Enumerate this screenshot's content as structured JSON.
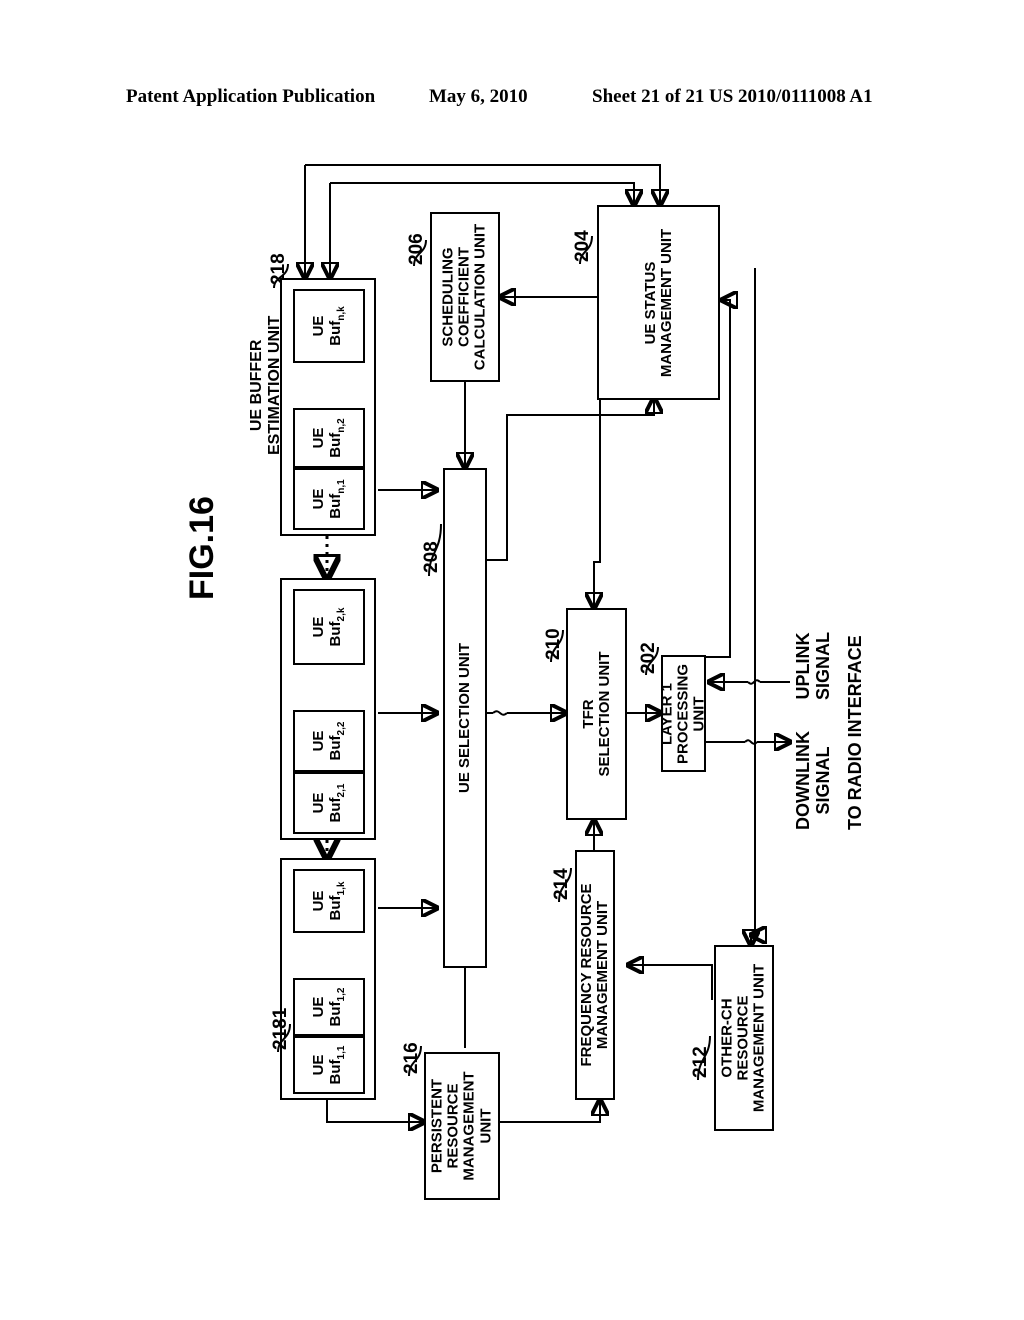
{
  "header": {
    "publication": "Patent Application Publication",
    "date": "May 6, 2010",
    "sheet": "Sheet 21 of 21",
    "patent_number": "US 2010/0111008 A1"
  },
  "figure": {
    "title": "FIG.16"
  },
  "blocks": {
    "ue_buffer_estimation": {
      "label": "UE BUFFER\nESTIMATION UNIT",
      "ref": "218"
    },
    "scheduling_coefficient": {
      "label": "SCHEDULING\nCOEFFICIENT\nCALCULATION UNIT",
      "ref": "206"
    },
    "ue_status_management": {
      "label": "UE STATUS\nMANAGEMENT UNIT",
      "ref": "204"
    },
    "ue_selection": {
      "label": "UE SELECTION UNIT",
      "ref": "208"
    },
    "tfr_selection": {
      "label": "TFR\nSELECTION UNIT",
      "ref": "210"
    },
    "layer1_processing": {
      "label": "LAYER 1\nPROCESSING\nUNIT",
      "ref": "202"
    },
    "frequency_resource_management": {
      "label": "FREQUENCY RESOURCE\nMANAGEMENT UNIT",
      "ref": "214"
    },
    "persistent_resource_management": {
      "label": "PERSISTENT\nRESOURCE\nMANAGEMENT\nUNIT",
      "ref": "216"
    },
    "other_ch_resource_management": {
      "label": "OTHER-CH\nRESOURCE\nMANAGEMENT UNIT",
      "ref": "212"
    },
    "buffer_group_1": {
      "ref": "2181"
    }
  },
  "buffers": {
    "group_n": [
      {
        "line1": "UE",
        "line2": "Buf",
        "sub": "n,1"
      },
      {
        "line1": "UE",
        "line2": "Buf",
        "sub": "n,2"
      },
      {
        "line1": "UE",
        "line2": "Buf",
        "sub": "n,k"
      }
    ],
    "group_2": [
      {
        "line1": "UE",
        "line2": "Buf",
        "sub": "2,1"
      },
      {
        "line1": "UE",
        "line2": "Buf",
        "sub": "2,2"
      },
      {
        "line1": "UE",
        "line2": "Buf",
        "sub": "2,k"
      }
    ],
    "group_1": [
      {
        "line1": "UE",
        "line2": "Buf",
        "sub": "1,1"
      },
      {
        "line1": "UE",
        "line2": "Buf",
        "sub": "1,2"
      },
      {
        "line1": "UE",
        "line2": "Buf",
        "sub": "1,k"
      }
    ]
  },
  "signals": {
    "uplink": "UPLINK\nSIGNAL",
    "downlink": "DOWNLINK\nSIGNAL",
    "radio_interface": "TO RADIO INTERFACE"
  },
  "colors": {
    "ink": "#000000",
    "paper": "#ffffff"
  }
}
